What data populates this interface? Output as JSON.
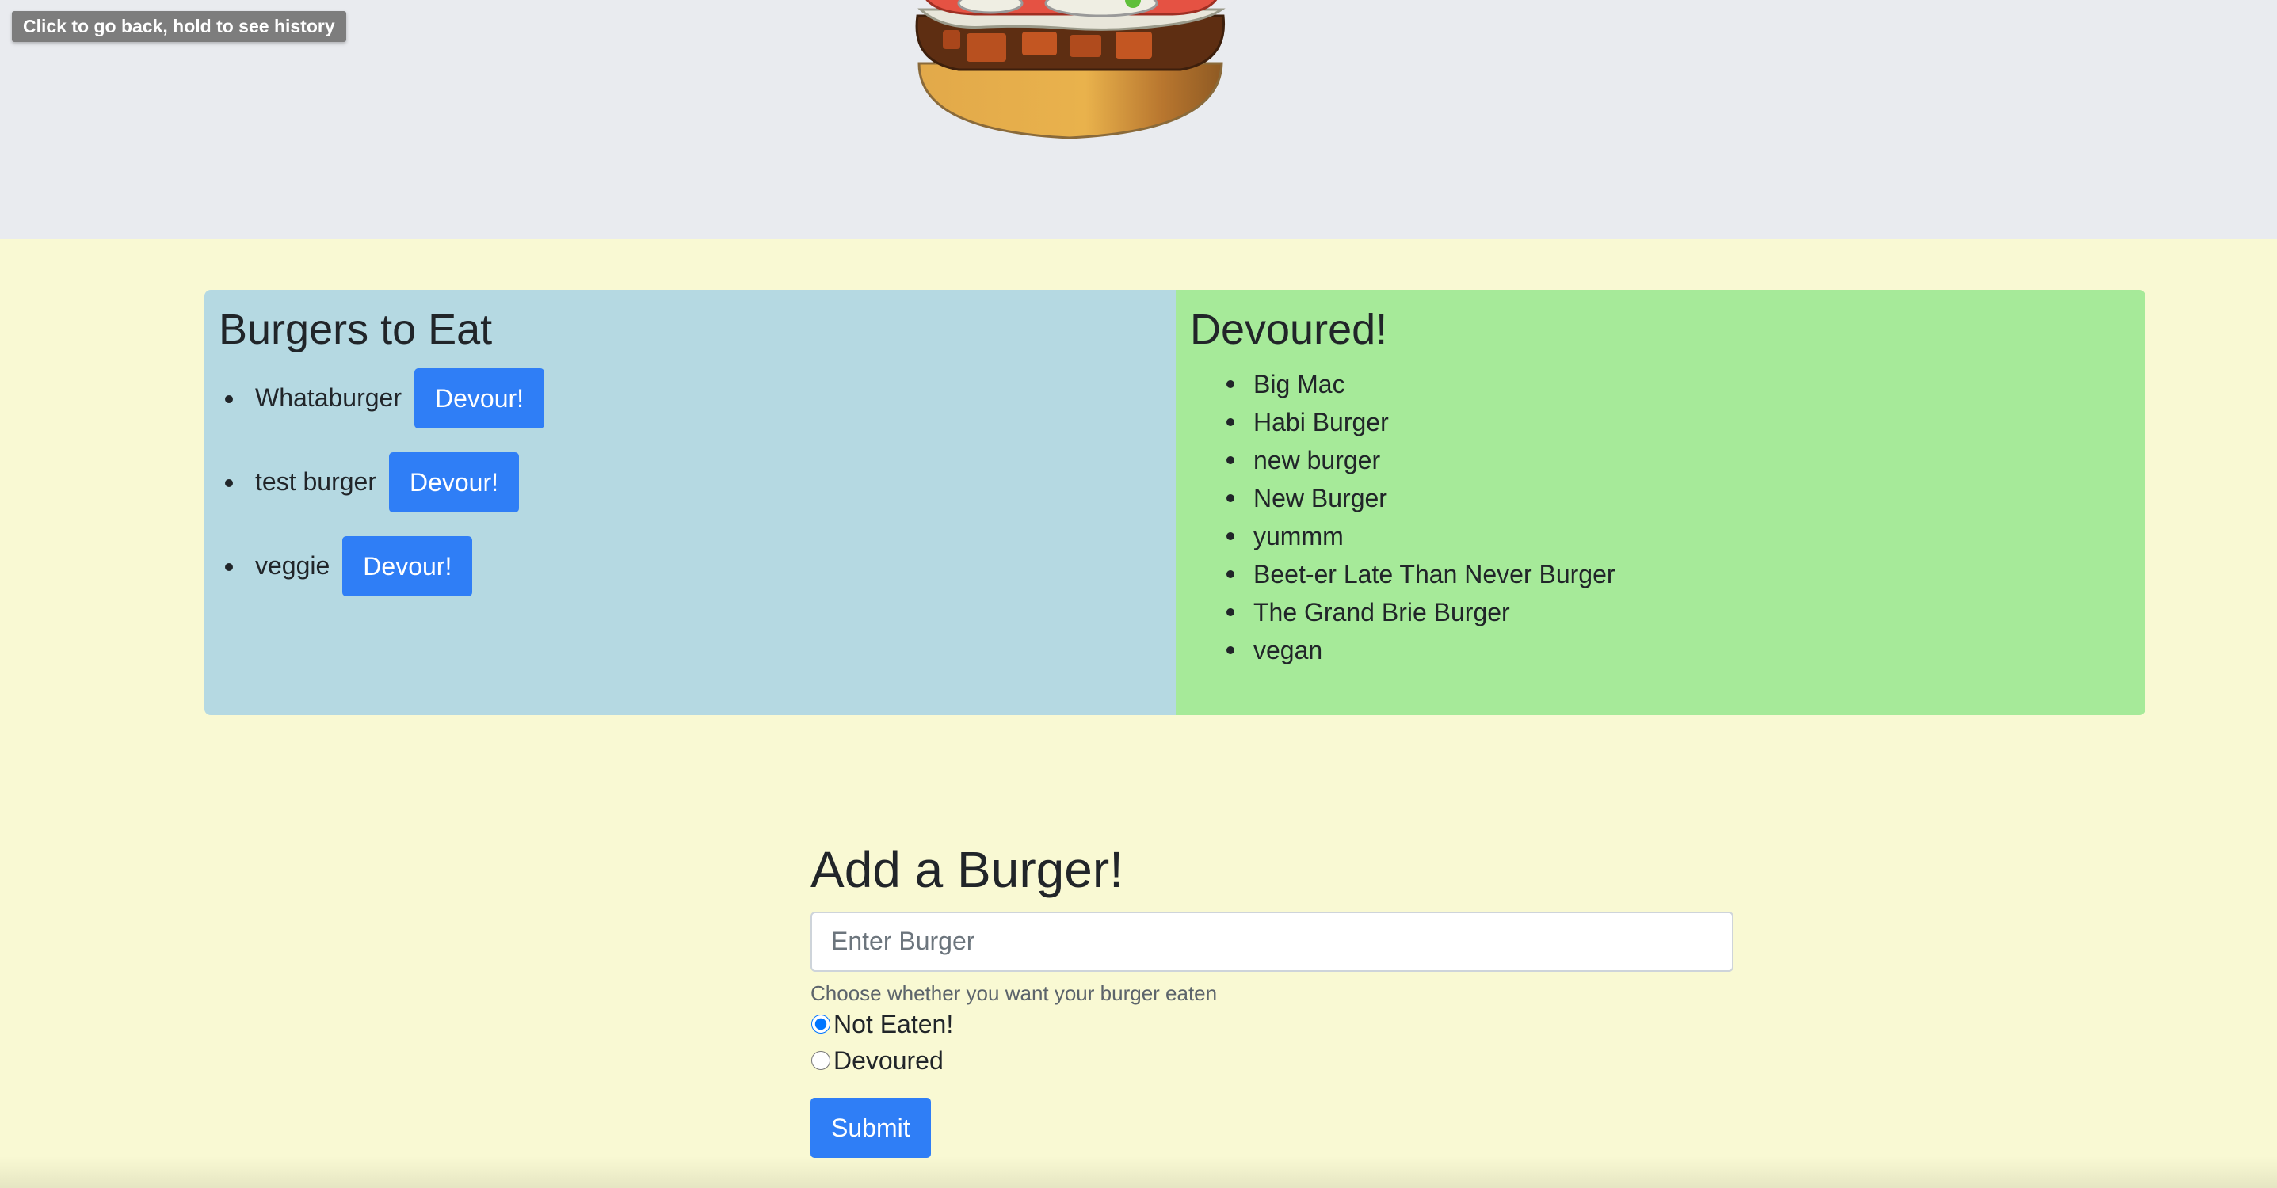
{
  "tooltip": {
    "back_history": "Click to go back, hold to see history"
  },
  "hero": {
    "image_icon": "burger-illustration"
  },
  "to_eat": {
    "title": "Burgers to Eat",
    "devour_label": "Devour!",
    "items": [
      {
        "name": "Whataburger"
      },
      {
        "name": "test burger"
      },
      {
        "name": "veggie"
      }
    ]
  },
  "devoured": {
    "title": "Devoured!",
    "items": [
      "Big Mac",
      "Habi Burger",
      "new burger",
      "New Burger",
      "yummm",
      "Beet-er Late Than Never Burger",
      "The Grand Brie Burger",
      "vegan"
    ]
  },
  "add_form": {
    "title": "Add a Burger!",
    "input_placeholder": "Enter Burger",
    "input_value": "",
    "help_text": "Choose whether you want your burger eaten",
    "options": [
      {
        "label": "Not Eaten!",
        "checked": true
      },
      {
        "label": "Devoured",
        "checked": false
      }
    ],
    "submit_label": "Submit"
  },
  "colors": {
    "page_bg": "#f9f9d3",
    "hero_bg": "#e9ebef",
    "to_eat_panel": "#b5d9e2",
    "devoured_panel": "#a6ea99",
    "button": "#2f7ef6"
  }
}
